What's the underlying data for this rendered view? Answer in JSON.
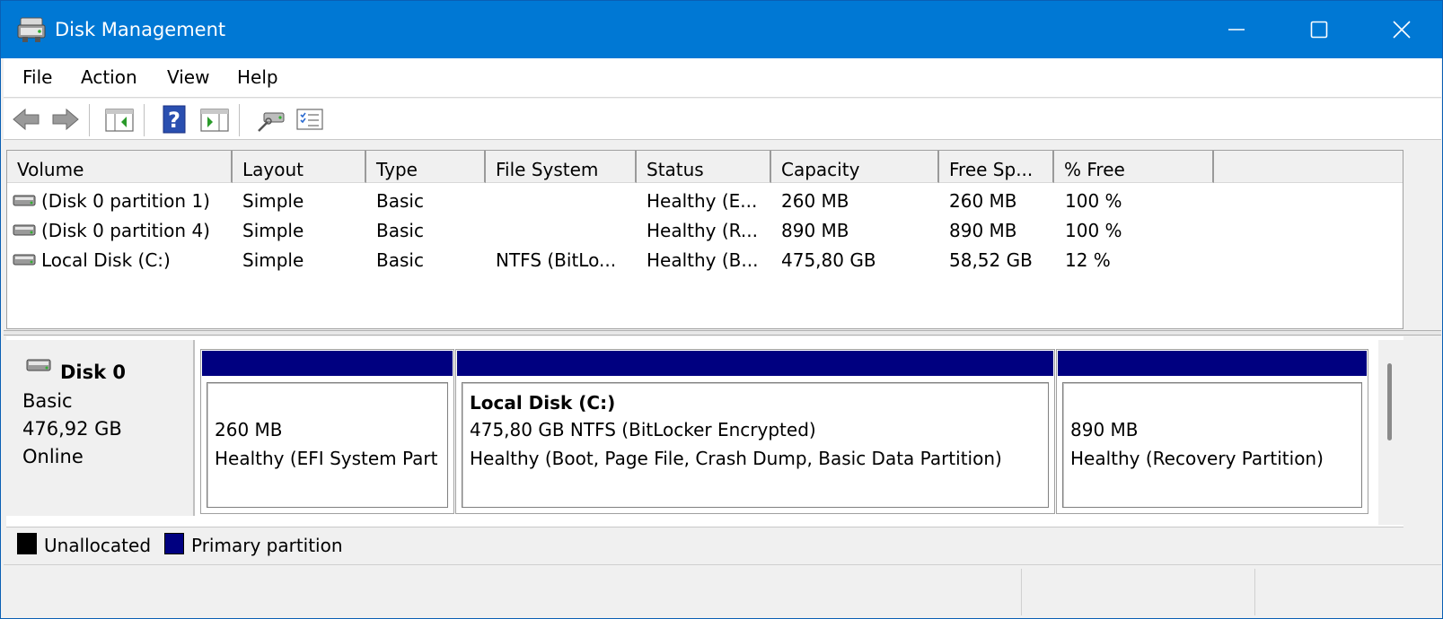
{
  "window": {
    "title": "Disk Management",
    "icon": "disk-management-icon"
  },
  "menu": {
    "items": [
      "File",
      "Action",
      "View",
      "Help"
    ]
  },
  "toolbar": {
    "buttons": [
      "back-arrow-icon",
      "forward-arrow-icon",
      "show-hide-console-tree-icon",
      "help-icon",
      "show-hide-action-pane-icon",
      "connect-icon",
      "properties-icon"
    ]
  },
  "volume_list": {
    "columns": [
      "Volume",
      "Layout",
      "Type",
      "File System",
      "Status",
      "Capacity",
      "Free Sp...",
      "% Free"
    ],
    "rows": [
      [
        "(Disk 0 partition 1)",
        "Simple",
        "Basic",
        "",
        "Healthy (E...",
        "260 MB",
        "260 MB",
        "100 %"
      ],
      [
        "(Disk 0 partition 4)",
        "Simple",
        "Basic",
        "",
        "Healthy (R...",
        "890 MB",
        "890 MB",
        "100 %"
      ],
      [
        "Local Disk (C:)",
        "Simple",
        "Basic",
        "NTFS (BitLo...",
        "Healthy (B...",
        "475,80 GB",
        "58,52 GB",
        "12 %"
      ]
    ]
  },
  "disk": {
    "name": "Disk 0",
    "type": "Basic",
    "size": "476,92 GB",
    "status": "Online",
    "partitions": [
      {
        "title": "",
        "line1": "260 MB",
        "line2": "Healthy (EFI System Part"
      },
      {
        "title": "Local Disk  (C:)",
        "line1": "475,80 GB NTFS (BitLocker Encrypted)",
        "line2": "Healthy (Boot, Page File, Crash Dump, Basic Data Partition)"
      },
      {
        "title": "",
        "line1": "890 MB",
        "line2": "Healthy (Recovery Partition)"
      }
    ]
  },
  "legend": {
    "unallocated": "Unallocated",
    "primary": "Primary partition"
  },
  "colors": {
    "titlebar": "#0078d4",
    "primary_partition": "#000080",
    "unallocated": "#000000"
  }
}
